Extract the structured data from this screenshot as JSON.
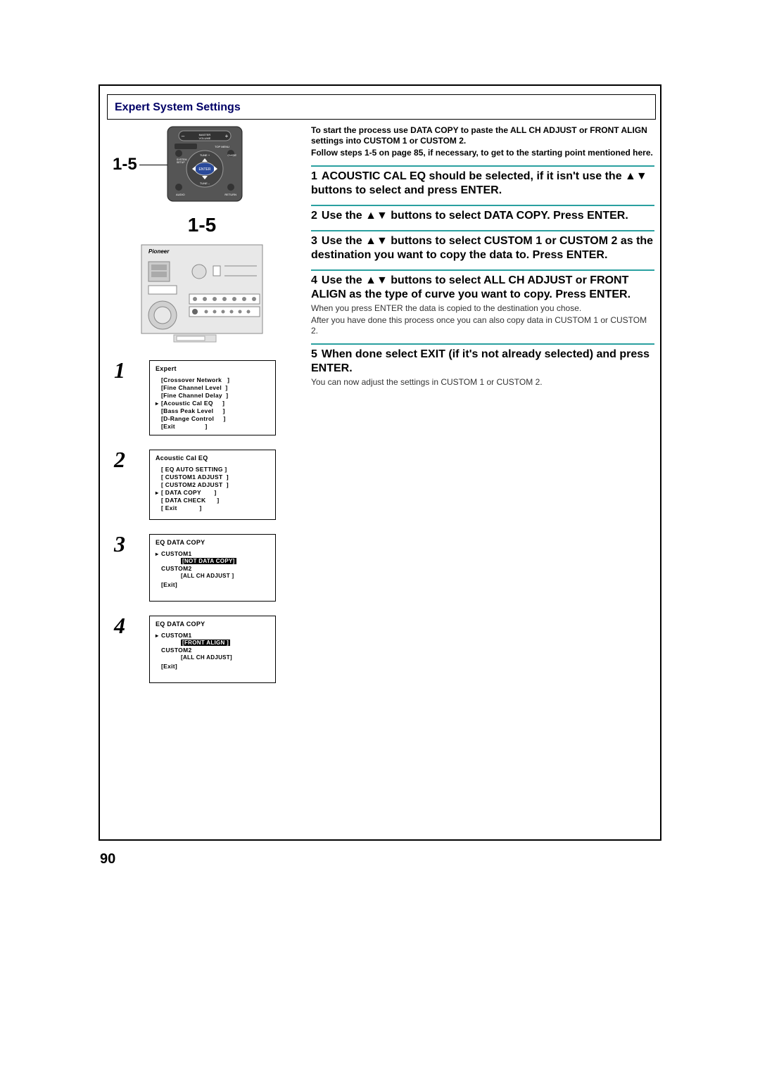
{
  "section_title": "Expert System Settings",
  "page_number": "90",
  "callout_label_top": "1-5",
  "callout_label_mid": "1-5",
  "remote": {
    "master_volume": "MASTER VOLUME",
    "top_menu": "TOP MENU",
    "guide": "GUIDE",
    "enter": "ENTER",
    "return": "RETURN",
    "audio": "AUDIO",
    "tune_plus": "TUNE +",
    "tune_minus": "TUNE –",
    "system_setup": "SYSTEM SETUP"
  },
  "osd1": {
    "title": "Expert",
    "items": [
      "[Crossover Network   ]",
      "[Fine Channel Level  ]",
      "[Fine Channel Delay  ]",
      "[Acoustic Cal EQ     ]",
      "[Bass Peak Level     ]",
      "[D-Range Control     ]",
      "[Exit                ]"
    ],
    "selected_index": 3
  },
  "osd2": {
    "title": "Acoustic  Cal  EQ",
    "items": [
      "[ EQ AUTO SETTING ]",
      "[ CUSTOM1 ADJUST  ]",
      "[ CUSTOM2 ADJUST  ]",
      "[ DATA COPY       ]",
      "[ DATA CHECK      ]",
      "[ Exit            ]"
    ],
    "selected_index": 3
  },
  "osd3": {
    "title": "EQ DATA COPY",
    "custom1": "CUSTOM1",
    "custom1_status": "[NOT DATA COPY]",
    "custom2": "CUSTOM2",
    "custom2_status": "[ALL CH ADJUST ]",
    "exit": "[Exit]"
  },
  "osd4": {
    "title": "EQ DATA COPY",
    "custom1": "CUSTOM1",
    "custom1_status": "[FRONT ALIGN    ]",
    "custom2": "CUSTOM2",
    "custom2_status": "[ALL CH ADJUST]",
    "exit": "[Exit]"
  },
  "intro_line1": "To start the process use DATA COPY to paste the ALL CH ADJUST or FRONT ALIGN settings into CUSTOM 1 or CUSTOM 2.",
  "intro_line2": "Follow steps 1-5 on page 85, if necessary, to get to the starting point mentioned here.",
  "step1": "ACOUSTIC CAL EQ should be selected, if it isn't use the ▲▼ buttons to select and press ENTER.",
  "step2": "Use the ▲▼ buttons to select DATA COPY. Press ENTER.",
  "step3": "Use the ▲▼ buttons to select CUSTOM 1 or CUSTOM 2 as the destination you want to copy the data to. Press ENTER.",
  "step4": "Use the ▲▼ buttons to select ALL CH ADJUST or FRONT ALIGN as the type of curve you want to copy. Press ENTER.",
  "step4_body1": "When you press ENTER the data is copied to the destination you chose.",
  "step4_body2": "After you have done this process once you can also copy data in CUSTOM 1 or CUSTOM 2.",
  "step5": "When done select EXIT (if it's not already selected) and press ENTER.",
  "step5_body": "You can now adjust the settings in CUSTOM 1 or CUSTOM 2.",
  "nums": {
    "n1": "1",
    "n2": "2",
    "n3": "3",
    "n4": "4",
    "n5": "5"
  }
}
